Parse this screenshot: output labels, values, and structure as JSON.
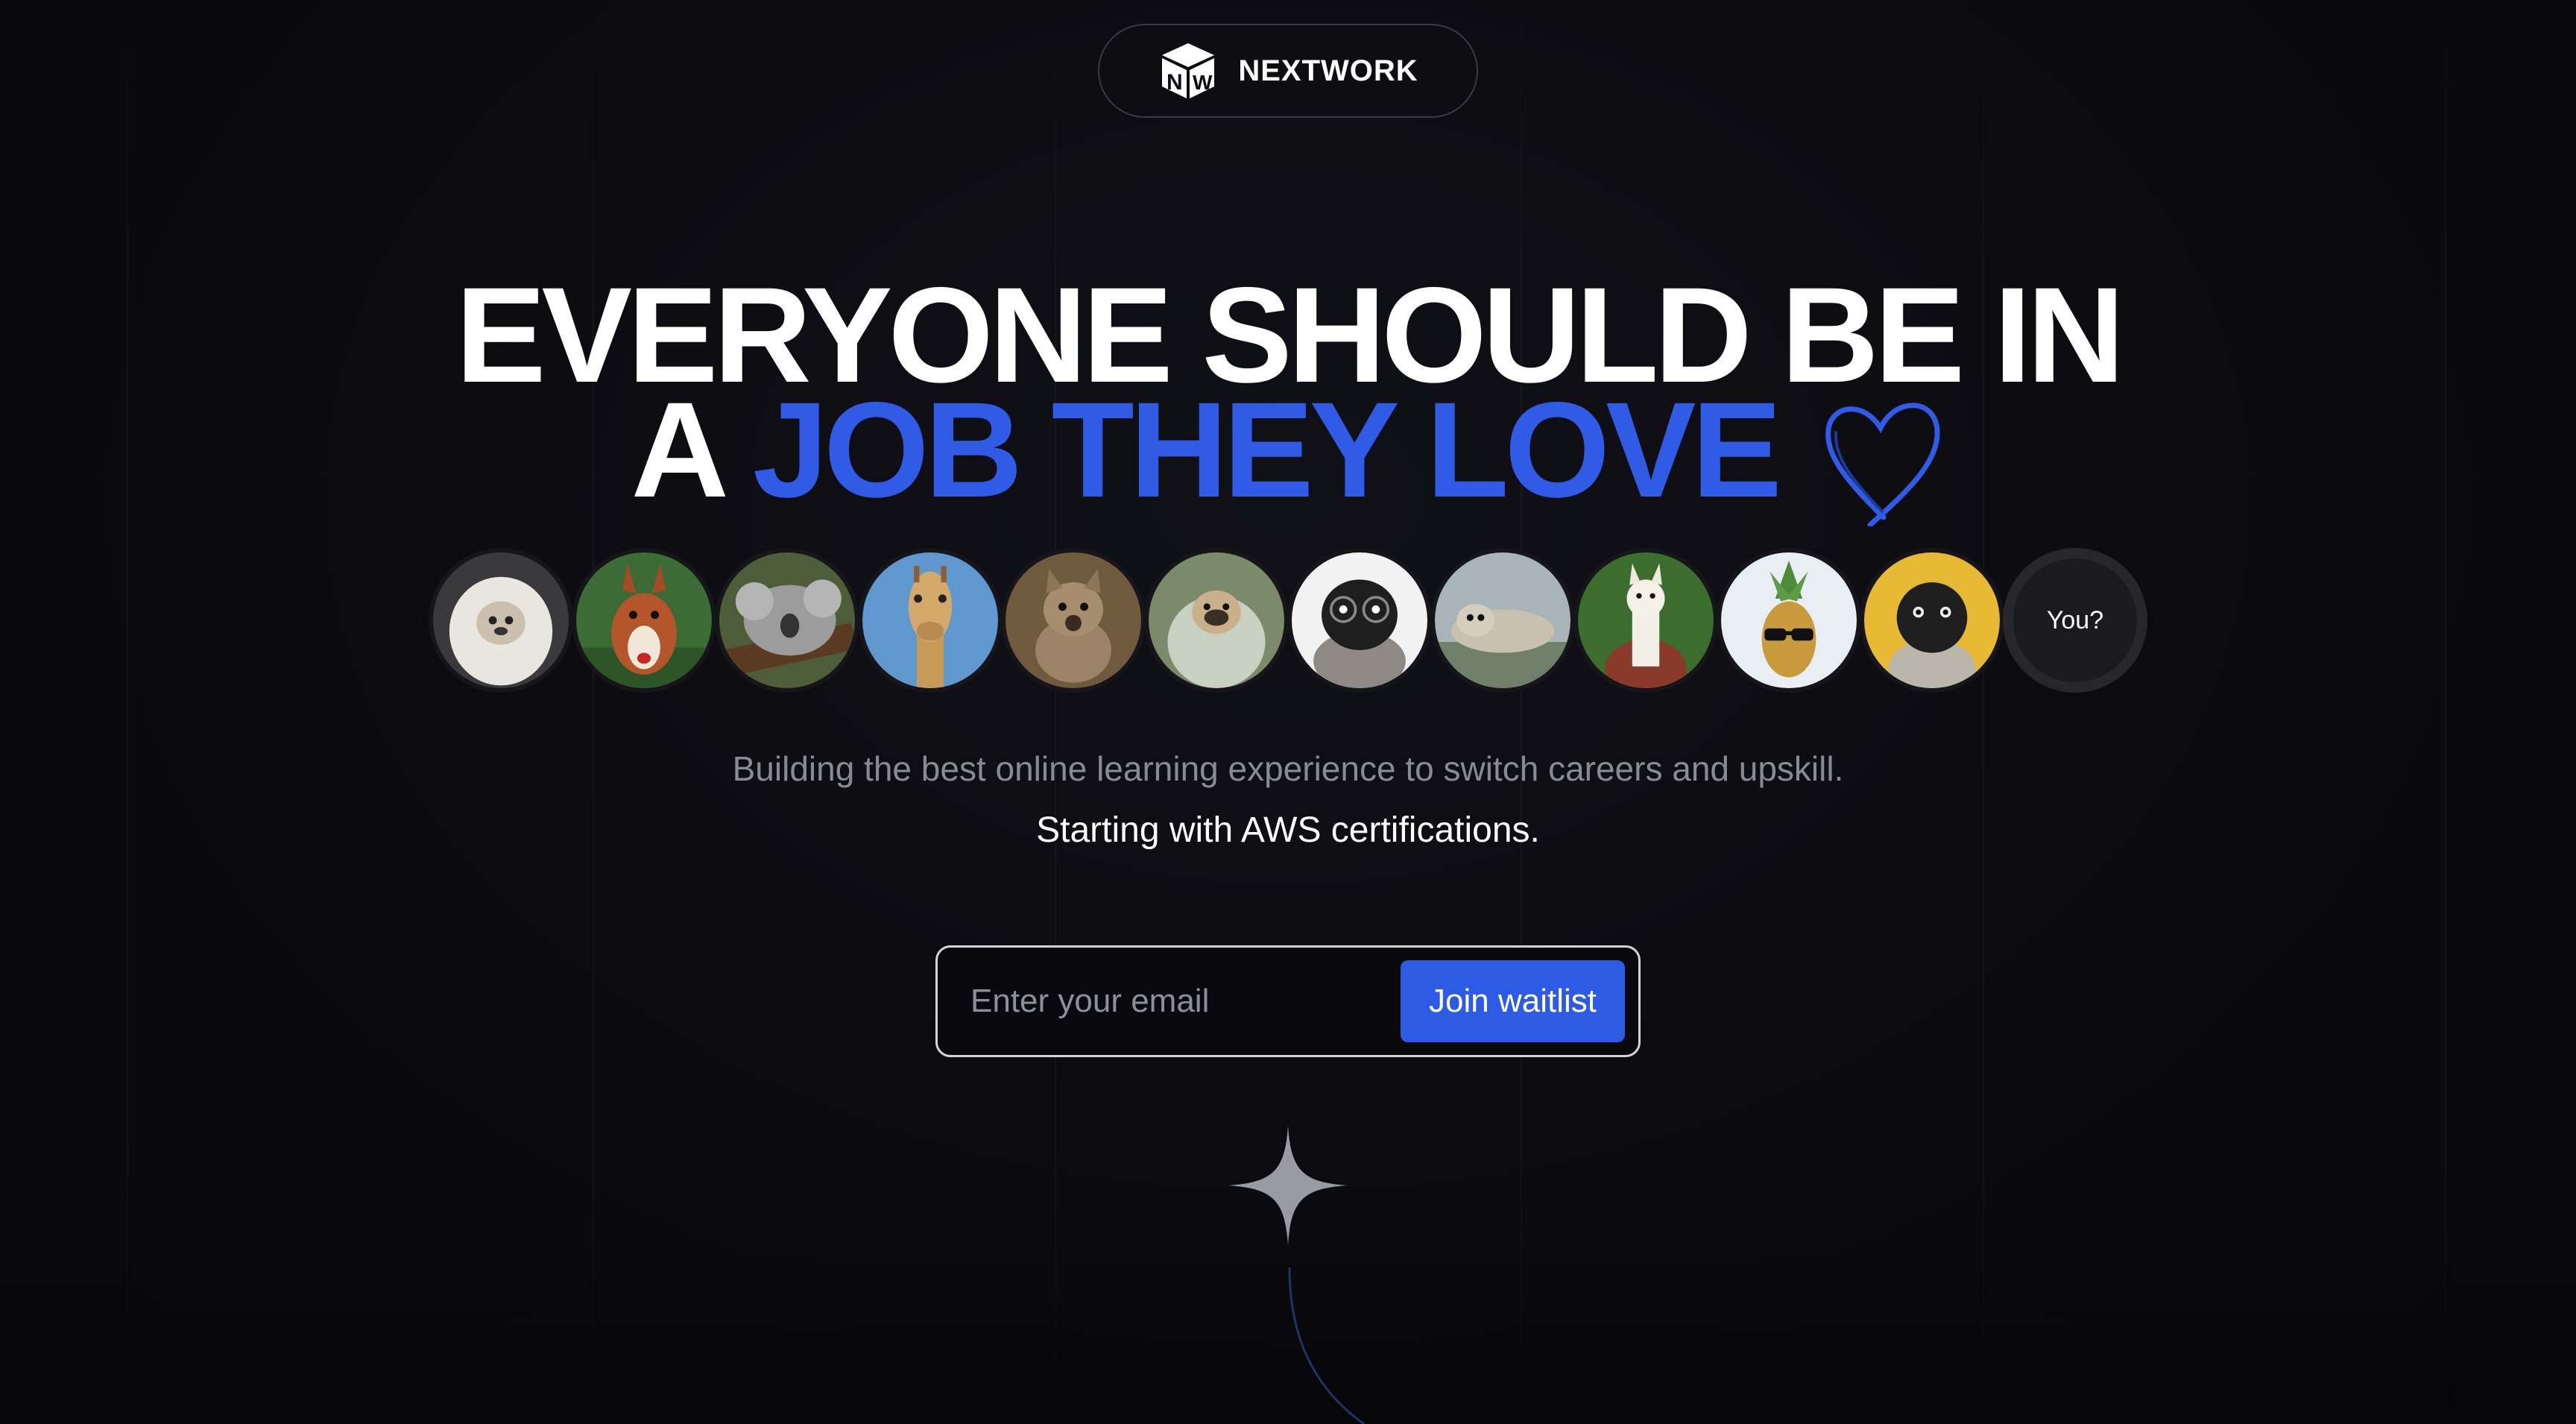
{
  "brand": {
    "logo_icon": "nw-cube-logo-icon",
    "name": "NEXTWORK"
  },
  "headline": {
    "line1": "EVERYONE SHOULD BE IN",
    "line2_prefix": "A",
    "line2_highlight": "JOB THEY LOVE",
    "heart_icon": "heart-outline-icon",
    "highlight_color": "#2f5be6"
  },
  "avatars": {
    "items": [
      {
        "name": "fluffy-dog-avatar"
      },
      {
        "name": "squirrel-avatar"
      },
      {
        "name": "koala-avatar"
      },
      {
        "name": "giraffe-avatar"
      },
      {
        "name": "kitten-avatar"
      },
      {
        "name": "pug-blanket-avatar"
      },
      {
        "name": "pug-glasses-avatar"
      },
      {
        "name": "seal-avatar"
      },
      {
        "name": "llama-avatar"
      },
      {
        "name": "pineapple-sunglasses-avatar"
      },
      {
        "name": "black-pug-avatar"
      }
    ],
    "you_label": "You?"
  },
  "subtext": {
    "line1": "Building the best online learning experience to switch careers and upskill.",
    "line2": "Starting with AWS certifications."
  },
  "waitlist": {
    "email_placeholder": "Enter your email",
    "email_value": "",
    "button_label": "Join waitlist",
    "button_color": "#2d5be3"
  },
  "decor": {
    "sparkle_icon": "sparkle-icon"
  }
}
